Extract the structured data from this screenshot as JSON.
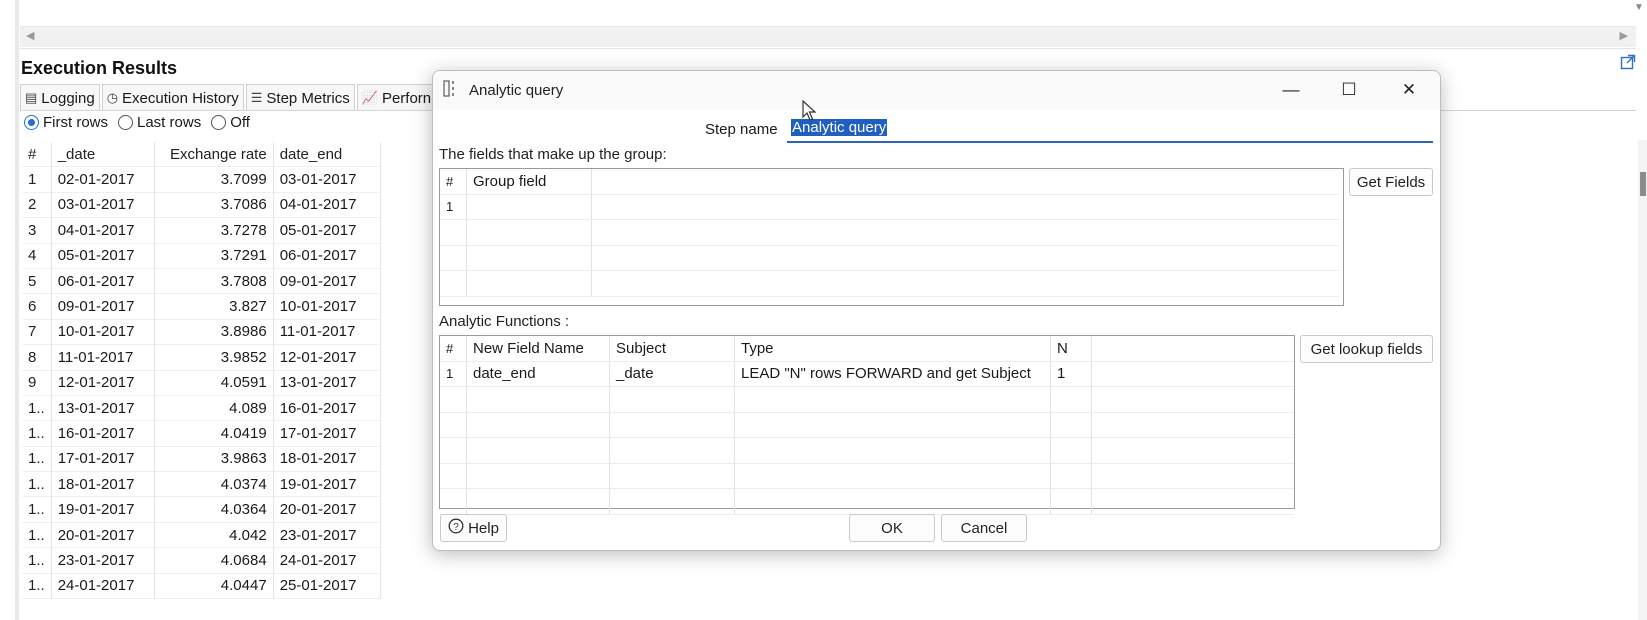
{
  "section_title": "Execution Results",
  "tabs": [
    {
      "label": "Logging",
      "icon": "document-icon"
    },
    {
      "label": "Execution History",
      "icon": "clock-icon"
    },
    {
      "label": "Step Metrics",
      "icon": "list-icon"
    },
    {
      "label": "Perforn",
      "icon": "chart-icon"
    }
  ],
  "preview_options": {
    "first_rows": "First rows",
    "last_rows": "Last rows",
    "off": "Off",
    "selected": "First rows"
  },
  "results": {
    "headers": [
      "#",
      "_date",
      "Exchange rate",
      "date_end"
    ],
    "rows": [
      [
        "1",
        "02-01-2017",
        "3.7099",
        "03-01-2017"
      ],
      [
        "2",
        "03-01-2017",
        "3.7086",
        "04-01-2017"
      ],
      [
        "3",
        "04-01-2017",
        "3.7278",
        "05-01-2017"
      ],
      [
        "4",
        "05-01-2017",
        "3.7291",
        "06-01-2017"
      ],
      [
        "5",
        "06-01-2017",
        "3.7808",
        "09-01-2017"
      ],
      [
        "6",
        "09-01-2017",
        "3.827",
        "10-01-2017"
      ],
      [
        "7",
        "10-01-2017",
        "3.8986",
        "11-01-2017"
      ],
      [
        "8",
        "11-01-2017",
        "3.9852",
        "12-01-2017"
      ],
      [
        "9",
        "12-01-2017",
        "4.0591",
        "13-01-2017"
      ],
      [
        "1..",
        "13-01-2017",
        "4.089",
        "16-01-2017"
      ],
      [
        "1..",
        "16-01-2017",
        "4.0419",
        "17-01-2017"
      ],
      [
        "1..",
        "17-01-2017",
        "3.9863",
        "18-01-2017"
      ],
      [
        "1..",
        "18-01-2017",
        "4.0374",
        "19-01-2017"
      ],
      [
        "1..",
        "19-01-2017",
        "4.0364",
        "20-01-2017"
      ],
      [
        "1..",
        "20-01-2017",
        "4.042",
        "23-01-2017"
      ],
      [
        "1..",
        "23-01-2017",
        "4.0684",
        "24-01-2017"
      ],
      [
        "1..",
        "24-01-2017",
        "4.0447",
        "25-01-2017"
      ]
    ]
  },
  "dialog": {
    "title": "Analytic query",
    "step_name_label": "Step name",
    "step_name_value": "Analytic query",
    "group_label": "The fields that make up the group:",
    "group_table": {
      "headers": [
        "#",
        "Group field"
      ],
      "rows": [
        [
          "1",
          ""
        ]
      ]
    },
    "get_fields_button": "Get Fields",
    "functions_label": "Analytic Functions :",
    "functions_table": {
      "headers": [
        "#",
        "New Field Name",
        "Subject",
        "Type",
        "N"
      ],
      "rows": [
        [
          "1",
          "date_end",
          "_date",
          "LEAD \"N\" rows FORWARD and get Subject",
          "1"
        ]
      ]
    },
    "get_lookup_button": "Get lookup fields",
    "help_button": "Help",
    "ok_button": "OK",
    "cancel_button": "Cancel"
  }
}
